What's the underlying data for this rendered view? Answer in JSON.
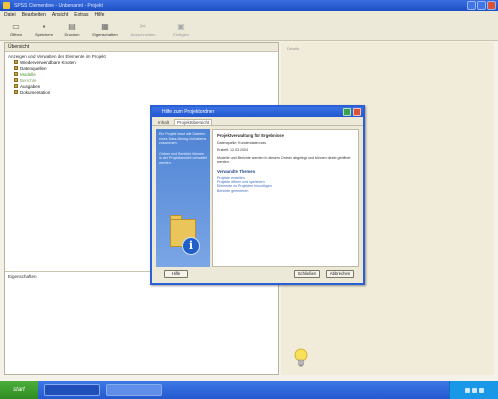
{
  "window": {
    "title": "SPSS Clementine - Unbenannt - Projekt",
    "controls": [
      "minimize",
      "maximize",
      "close"
    ]
  },
  "menu": [
    "Datei",
    "Bearbeiten",
    "Ansicht",
    "Extras",
    "Hilfe"
  ],
  "toolbar": [
    {
      "label": "Öffnen",
      "icon": "folder-icon",
      "enabled": true
    },
    {
      "label": "Speichern",
      "icon": "save-icon",
      "enabled": true
    },
    {
      "label": "Drucken",
      "icon": "print-icon",
      "enabled": true
    },
    {
      "label": "Eigenschaften",
      "icon": "properties-icon",
      "enabled": true
    },
    {
      "label": "Ausschneiden",
      "icon": "cut-icon",
      "enabled": false
    },
    {
      "label": "Einfügen",
      "icon": "paste-icon",
      "enabled": false
    }
  ],
  "left_pane": {
    "header": "Übersicht",
    "root": "Anzeigen und Verwalten der Elemente im Projekt",
    "items": [
      {
        "label": "Wiederverwendbare Knoten",
        "style": "normal"
      },
      {
        "label": "Datenquellen",
        "style": "normal"
      },
      {
        "label": "Modelle",
        "style": "green"
      },
      {
        "label": "Berichte",
        "style": "dim"
      },
      {
        "label": "Ausgaben",
        "style": "normal"
      },
      {
        "label": "Dokumentation",
        "style": "normal"
      }
    ],
    "lower_label": "Eigenschaften"
  },
  "right_pane": {
    "label": "Details"
  },
  "dialog": {
    "title": "Hilfe zum Projektordner",
    "tabs": [
      "Inhalt",
      "Projektübersicht"
    ],
    "left_text": [
      "Ein Projekt fasst alle Dateien eines Data-Mining-Vorhabens zusammen.",
      "Ordner und Berichte können in der Projektansicht verwaltet werden."
    ],
    "heading": "Projektverwaltung für Ergebnisse",
    "paragraphs": [
      "Datenquelle: Kundendaten.sav",
      "Erstellt: 12.03.2004",
      "Modelle und Berichte werden in diesem Ordner abgelegt und können direkt geöffnet werden."
    ],
    "section": "Verwandte Themen",
    "links": [
      "Projekte erstellen",
      "Projekte öffnen und speichern",
      "Elemente zu Projekten hinzufügen",
      "Berichte generieren"
    ],
    "buttons": {
      "help": "Hilfe",
      "close": "Schließen",
      "cancel": "Abbrechen"
    }
  }
}
